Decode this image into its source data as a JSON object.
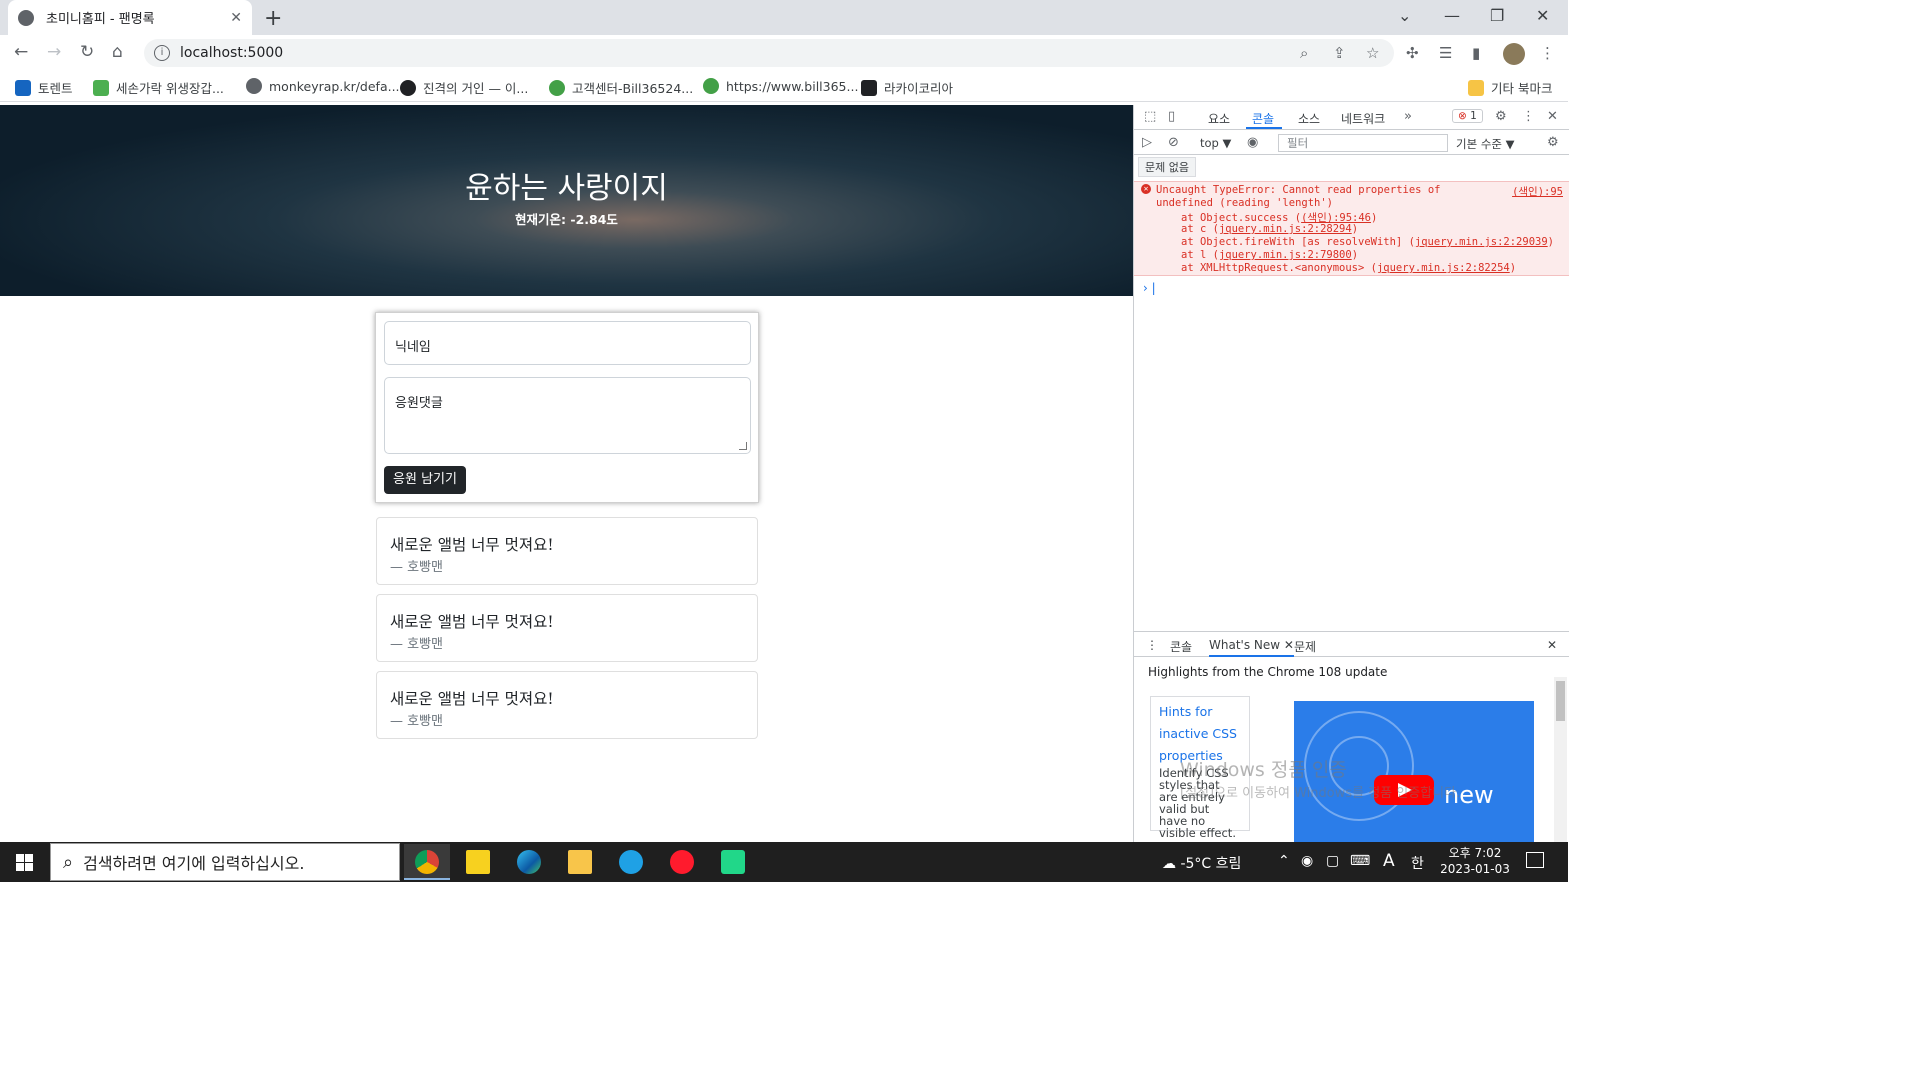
{
  "browser": {
    "tab_title": "초미니홈피 - 팬명록",
    "url": "localhost:5000",
    "bookmarks": [
      {
        "label": "토렌트",
        "color": "#1565c0"
      },
      {
        "label": "세손가락 위생장갑...",
        "color": "#4caf50"
      },
      {
        "label": "monkeyrap.kr/defa...",
        "color": "#5f6368"
      },
      {
        "label": "진격의 거인 — 이...",
        "color": "#202124"
      },
      {
        "label": "고객센터-Bill36524...",
        "color": "#43a047"
      },
      {
        "label": "https://www.bill365...",
        "color": "#43a047"
      },
      {
        "label": "라카이코리아",
        "color": "#202124"
      }
    ],
    "other_bookmarks": "기타 북마크"
  },
  "page": {
    "title": "윤하는 사랑이지",
    "temperature": "현재기온: -2.84도",
    "form": {
      "nickname_placeholder": "닉네임",
      "comment_placeholder": "응원댓글",
      "submit_label": "응원 남기기"
    },
    "comments": [
      {
        "message": "새로운 앨범 너무 멋져요!",
        "author": "— 호빵맨"
      },
      {
        "message": "새로운 앨범 너무 멋져요!",
        "author": "— 호빵맨"
      },
      {
        "message": "새로운 앨범 너무 멋져요!",
        "author": "— 호빵맨"
      }
    ]
  },
  "devtools": {
    "tabs": [
      "요소",
      "콘솔",
      "소스",
      "네트워크"
    ],
    "active_tab": "콘솔",
    "error_count": "1",
    "context": "top ▼",
    "filter_placeholder": "필터",
    "level": "기본 수준 ▼",
    "issues_button": "문제 없음",
    "error": {
      "line1": "Uncaught TypeError: Cannot read properties of",
      "line2": "undefined (reading 'length')",
      "source": "(색인):95",
      "stack": [
        {
          "prefix": "at Object.success (",
          "link": "(색인):95:46",
          "suffix": ")"
        },
        {
          "prefix": "at c (",
          "link": "jquery.min.js:2:28294",
          "suffix": ")"
        },
        {
          "prefix": "at Object.fireWith [as resolveWith] (",
          "link": "jquery.min.js:2:29039",
          "suffix": ")"
        },
        {
          "prefix": "at l (",
          "link": "jquery.min.js:2:79800",
          "suffix": ")"
        },
        {
          "prefix": "at XMLHttpRequest.<anonymous> (",
          "link": "jquery.min.js:2:82254",
          "suffix": ")"
        }
      ]
    },
    "drawer": {
      "tabs": [
        "콘솔",
        "What's New",
        "문제"
      ],
      "highlights": "Highlights from the Chrome 108 update",
      "hint_title": "Hints for inactive CSS properties",
      "hint_desc": "Identify CSS styles that are entirely valid but have no visible effect.",
      "video_text": "new"
    }
  },
  "watermark": {
    "line1": "Windows 정품 인증",
    "line2": "[설정]으로 이동하여 Windows를 정품 인증합니다."
  },
  "taskbar": {
    "search_placeholder": "검색하려면 여기에 입력하십시오.",
    "weather": "-5°C  흐림",
    "ime_lang": "A",
    "ime_mode": "한",
    "time": "오후 7:02",
    "date": "2023-01-03"
  }
}
